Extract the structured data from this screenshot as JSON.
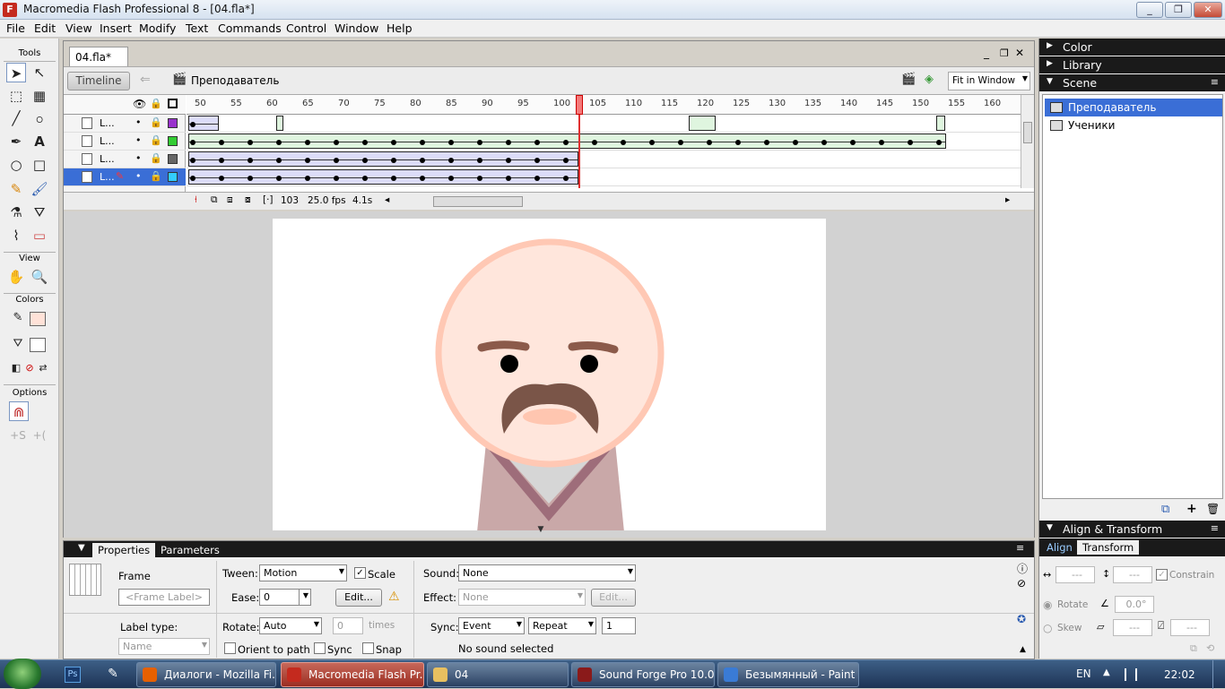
{
  "window": {
    "title": "Macromedia Flash Professional 8 - [04.fla*]",
    "app_icon": "F",
    "controls": {
      "min": "_",
      "max": "❐",
      "close": "✕"
    }
  },
  "menu": [
    "File",
    "Edit",
    "View",
    "Insert",
    "Modify",
    "Text",
    "Commands",
    "Control",
    "Window",
    "Help"
  ],
  "tools": {
    "title": "Tools",
    "view_label": "View",
    "colors_label": "Colors",
    "options_label": "Options",
    "swatch_fill": "#ffe2d8",
    "swatch_stroke": "#f4b8a4"
  },
  "document": {
    "tab": "04.fla*",
    "timeline_button": "Timeline",
    "scene_name": "Преподаватель",
    "zoom": "Fit in Window",
    "doc_controls": {
      "min": "_",
      "max": "❐",
      "close": "✕"
    }
  },
  "timeline": {
    "ruler": [
      "50",
      "55",
      "60",
      "65",
      "70",
      "75",
      "80",
      "85",
      "90",
      "95",
      "100",
      "105",
      "110",
      "115",
      "120",
      "125",
      "130",
      "135",
      "140",
      "145",
      "150",
      "155",
      "160"
    ],
    "layers": [
      {
        "name": "L...",
        "color": "#9932cc",
        "selected": false
      },
      {
        "name": "L...",
        "color": "#33cc33",
        "selected": false
      },
      {
        "name": "L...",
        "color": "#666666",
        "selected": false
      },
      {
        "name": "L...",
        "color": "#33ccff",
        "selected": true
      }
    ],
    "current_frame": "103",
    "fps": "25.0 fps",
    "time": "4.1s"
  },
  "properties": {
    "tabs": [
      "Properties",
      "Parameters"
    ],
    "frame_label": "Frame",
    "frame_label_placeholder": "<Frame Label>",
    "label_type_label": "Label type:",
    "label_type_value": "Name",
    "tween_label": "Tween:",
    "tween_value": "Motion",
    "scale_label": "Scale",
    "ease_label": "Ease:",
    "ease_value": "0",
    "edit_button": "Edit...",
    "rotate_label": "Rotate:",
    "rotate_value": "Auto",
    "times_value": "0",
    "times_label": "times",
    "orient_label": "Orient to path",
    "sync_chk_label": "Sync",
    "snap_label": "Snap",
    "sound_label": "Sound:",
    "sound_value": "None",
    "effect_label": "Effect:",
    "effect_value": "None",
    "effect_edit": "Edit...",
    "sync_label": "Sync:",
    "sync_value": "Event",
    "repeat_value": "Repeat",
    "repeat_count": "1",
    "no_sound": "No sound selected"
  },
  "right_panels": {
    "color": "Color",
    "library": "Library",
    "scene": "Scene",
    "scenes": [
      {
        "name": "Преподаватель",
        "selected": true
      },
      {
        "name": "Ученики",
        "selected": false
      }
    ],
    "align_transform": "Align & Transform",
    "tab_align": "Align",
    "tab_transform": "Transform",
    "width_val": "---",
    "height_val": "---",
    "constrain": "Constrain",
    "rotate": "Rotate",
    "rotate_val": "0.0°",
    "skew": "Skew",
    "skew_h": "---",
    "skew_v": "---"
  },
  "taskbar": {
    "items": [
      {
        "label": "Диалоги - Mozilla Fi...",
        "color": "#e66000",
        "active": false
      },
      {
        "label": "Macromedia Flash Pr...",
        "color": "#c42a1e",
        "active": true
      },
      {
        "label": "04",
        "color": "#e8c060",
        "active": false
      },
      {
        "label": "Sound Forge Pro 10.0",
        "color": "#8a1a1a",
        "active": false
      },
      {
        "label": "Безымянный - Paint",
        "color": "#3a7bd5",
        "active": false
      }
    ],
    "pinned": [
      "Ps",
      "✎"
    ],
    "lang": "EN",
    "time": "22:02"
  },
  "stage_colors": {
    "face": "#ffe6dc",
    "face_outline": "#ffc8b4",
    "brow": "#8b5a4a",
    "eye": "#000000",
    "mustache": "#7a5548",
    "nose": "#ffc6b0",
    "body": "#c9a8a8",
    "collar": "#9e6d7a",
    "shirt": "#d6d6d6"
  }
}
